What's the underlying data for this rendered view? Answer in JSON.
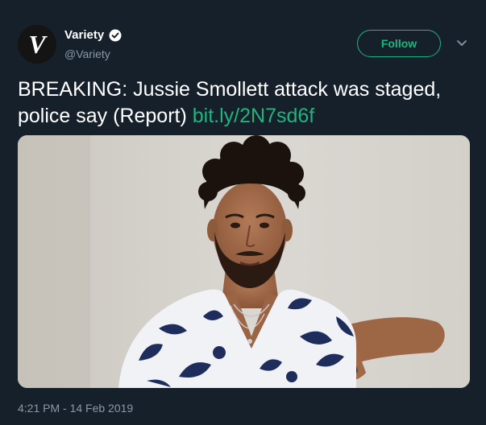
{
  "account": {
    "display_name": "Variety",
    "handle": "@Variety",
    "avatar_letter": "V",
    "verified": true
  },
  "follow_button": {
    "label": "Follow"
  },
  "tweet": {
    "text": "BREAKING: Jussie Smollett attack was staged, police say (Report)",
    "link": "bit.ly/2N7sd6f",
    "timestamp": "4:21 PM - 14 Feb 2019"
  },
  "media": {
    "type": "photo"
  },
  "colors": {
    "background": "#15202b",
    "accent": "#1db67c",
    "secondary_text": "#8899a6",
    "primary_text": "#ffffff"
  },
  "icons": {
    "verified": "verified-badge-icon",
    "menu": "chevron-down-icon"
  }
}
